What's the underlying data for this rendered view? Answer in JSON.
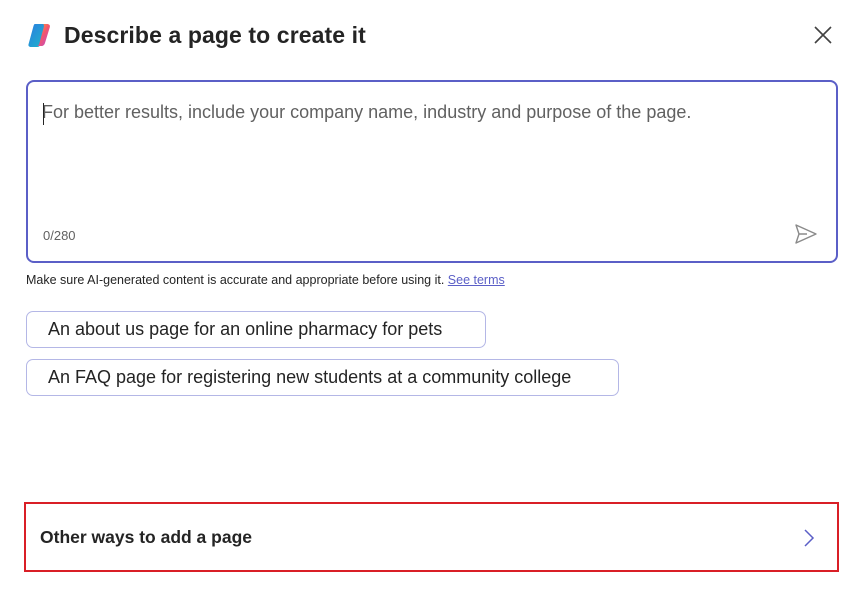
{
  "header": {
    "title": "Describe a page to create it",
    "logo_icon": "copilot-logo-icon",
    "close_icon": "close-icon"
  },
  "prompt": {
    "value": "",
    "placeholder": "For better results, include your company name, industry and purpose of the page.",
    "char_count": "0/280",
    "send_icon": "send-icon"
  },
  "disclaimer": {
    "text": "Make sure AI-generated content is accurate and appropriate before using it.",
    "link_label": "See terms"
  },
  "suggestions": [
    {
      "label": "An about us page for an online pharmacy for pets"
    },
    {
      "label": "An FAQ page for registering new students at a community college"
    }
  ],
  "other_ways": {
    "label": "Other ways to add a page",
    "chevron_icon": "chevron-right-icon"
  },
  "colors": {
    "accent": "#5b5fc7",
    "chip_border": "#b4b7e6",
    "highlight_border": "#d91f26"
  }
}
